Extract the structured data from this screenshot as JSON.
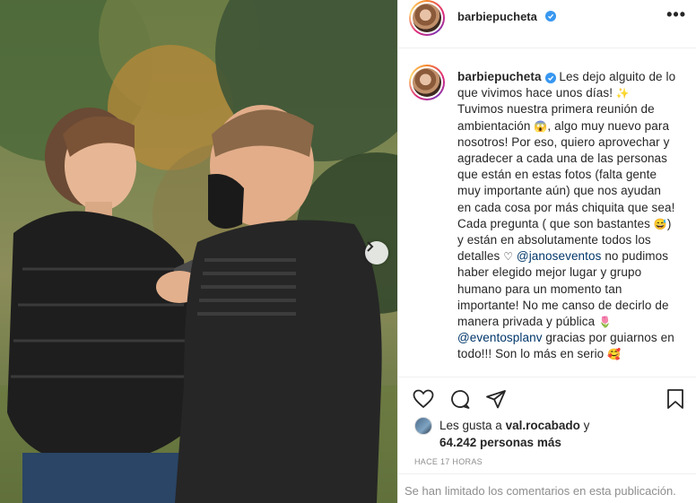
{
  "post": {
    "username": "barbiepucheta",
    "verified": true,
    "more_icon": "more-horizontal-icon",
    "caption": {
      "username": "barbiepucheta",
      "segments": [
        " Les dejo alguito de lo que vivimos hace unos días! ",
        " Tuvimos nuestra primera reunión de ambientación ",
        ", algo muy nuevo para nosotros! Por eso, quiero aprovechar y agradecer a cada una de las personas que están en estas fotos (falta gente muy importante aún) que nos ayudan en cada cosa por más chiquita que sea! Cada pregunta ( que son bastantes ",
        ") y están en absolutamente todos los detalles ",
        " no pudimos haber elegido mejor lugar y grupo humano para un momento tan importante! No me canso de decirlo de manera privada y pública ",
        " gracias por guiarnos en todo!!! Son lo más en serio "
      ],
      "mentions": [
        "@janoseventos",
        "@eventosplanv"
      ],
      "emojis": [
        "✨",
        "😱",
        "😅",
        "♡",
        "🌷",
        "🥰"
      ]
    },
    "likes": {
      "prefix": "Les gusta a",
      "user": "val.rocabado",
      "conjunction": "y",
      "count": "64.242 personas más"
    },
    "timestamp": "Hace 17 horas",
    "comments_notice": "Se han limitado los comentarios en esta publicación."
  },
  "colors": {
    "verified_blue": "#3897f0",
    "mention_blue": "#00376b",
    "muted_gray": "#8e8e8e",
    "text": "#262626"
  }
}
